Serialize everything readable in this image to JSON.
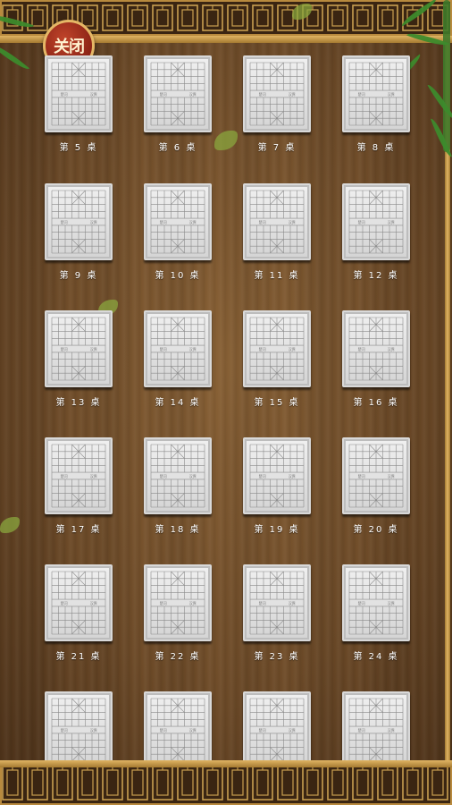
{
  "close_button": {
    "label": "关闭"
  },
  "tables": [
    {
      "label": "第 5 桌"
    },
    {
      "label": "第 6 桌"
    },
    {
      "label": "第 7 桌"
    },
    {
      "label": "第 8 桌"
    },
    {
      "label": "第 9 桌"
    },
    {
      "label": "第 10 桌"
    },
    {
      "label": "第 11 桌"
    },
    {
      "label": "第 12 桌"
    },
    {
      "label": "第 13 桌"
    },
    {
      "label": "第 14 桌"
    },
    {
      "label": "第 15 桌"
    },
    {
      "label": "第 16 桌"
    },
    {
      "label": "第 17 桌"
    },
    {
      "label": "第 18 桌"
    },
    {
      "label": "第 19 桌"
    },
    {
      "label": "第 20 桌"
    },
    {
      "label": "第 21 桌"
    },
    {
      "label": "第 22 桌"
    },
    {
      "label": "第 23 桌"
    },
    {
      "label": "第 24 桌"
    },
    {
      "label": ""
    },
    {
      "label": ""
    },
    {
      "label": ""
    },
    {
      "label": ""
    }
  ],
  "board_text": {
    "left": "楚河",
    "right": "汉界"
  },
  "colors": {
    "wood": "#6e4b28",
    "frame": "#3a2512",
    "gold": "#e0b463",
    "seal": "#8c2416"
  }
}
